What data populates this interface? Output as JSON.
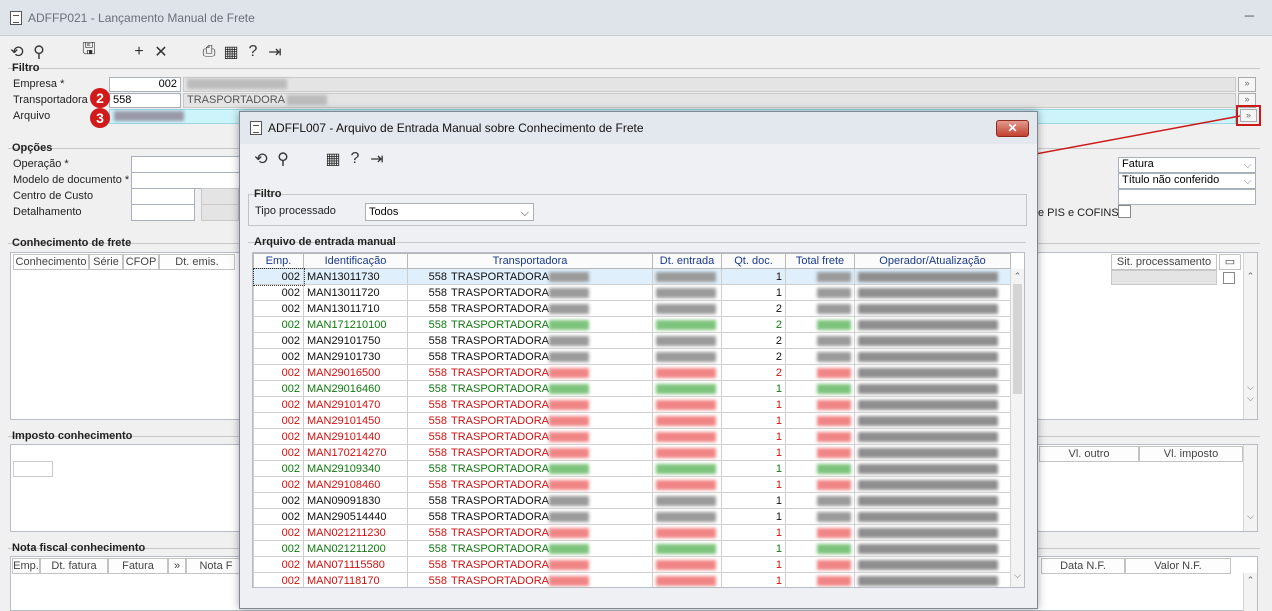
{
  "main_window": {
    "title": "ADFFP021 - Lançamento Manual de Frete",
    "minimize": "─"
  },
  "filtro": {
    "label": "Filtro",
    "empresa_label": "Empresa *",
    "empresa_value": "002",
    "transportadora_label": "Transportadora",
    "transportadora_value": "558",
    "transportadora_name": "TRASPORTADORA",
    "arquivo_label": "Arquivo"
  },
  "opcoes": {
    "label": "Opções",
    "operacao_label": "Operação *",
    "modelo_label": "Modelo de documento *",
    "centro_label": "Centro de Custo",
    "detalhamento_label": "Detalhamento",
    "select1": "Fatura",
    "select2": "Título não conferido",
    "pis_label": "e PIS e COFINS"
  },
  "conhecimento": {
    "label": "Conhecimento de frete",
    "columns": [
      "Conhecimento",
      "Série",
      "CFOP",
      "Dt. emis."
    ],
    "right_column": "Sit. processamento"
  },
  "imposto": {
    "label": "Imposto conhecimento",
    "columns": [
      "Vl. outro",
      "Vl. imposto"
    ]
  },
  "nota": {
    "label": "Nota fiscal conhecimento",
    "columns": [
      "Emp.",
      "Dt. fatura",
      "Fatura",
      "Nota F"
    ],
    "right_columns": [
      "Data N.F.",
      "Valor N.F."
    ]
  },
  "markers": [
    "2",
    "3"
  ],
  "modal": {
    "title": "ADFFL007 - Arquivo de Entrada Manual sobre Conhecimento de Frete",
    "close": "✕",
    "filtro_label": "Filtro",
    "tipo_label": "Tipo processado",
    "tipo_value": "Todos",
    "grid_label": "Arquivo de entrada manual",
    "columns": [
      "Emp.",
      "Identificação",
      "Transportadora",
      "Dt. entrada",
      "Qt. doc.",
      "Total frete",
      "Operador/Atualização"
    ],
    "rows": [
      {
        "emp": "002",
        "id": "MAN13011730",
        "tcode": "558",
        "tname": "TRASPORTADORA",
        "qt": "1",
        "color": "black"
      },
      {
        "emp": "002",
        "id": "MAN13011720",
        "tcode": "558",
        "tname": "TRASPORTADORA",
        "qt": "1",
        "color": "black"
      },
      {
        "emp": "002",
        "id": "MAN13011710",
        "tcode": "558",
        "tname": "TRASPORTADORA",
        "qt": "2",
        "color": "black"
      },
      {
        "emp": "002",
        "id": "MAN171210100",
        "tcode": "558",
        "tname": "TRASPORTADORA",
        "qt": "2",
        "color": "green"
      },
      {
        "emp": "002",
        "id": "MAN29101750",
        "tcode": "558",
        "tname": "TRASPORTADORA",
        "qt": "2",
        "color": "black"
      },
      {
        "emp": "002",
        "id": "MAN29101730",
        "tcode": "558",
        "tname": "TRASPORTADORA",
        "qt": "2",
        "color": "black"
      },
      {
        "emp": "002",
        "id": "MAN29016500",
        "tcode": "558",
        "tname": "TRASPORTADORA",
        "qt": "2",
        "color": "red"
      },
      {
        "emp": "002",
        "id": "MAN29016460",
        "tcode": "558",
        "tname": "TRASPORTADORA",
        "qt": "1",
        "color": "green"
      },
      {
        "emp": "002",
        "id": "MAN29101470",
        "tcode": "558",
        "tname": "TRASPORTADORA",
        "qt": "1",
        "color": "red"
      },
      {
        "emp": "002",
        "id": "MAN29101450",
        "tcode": "558",
        "tname": "TRASPORTADORA",
        "qt": "1",
        "color": "red"
      },
      {
        "emp": "002",
        "id": "MAN29101440",
        "tcode": "558",
        "tname": "TRASPORTADORA",
        "qt": "1",
        "color": "red"
      },
      {
        "emp": "002",
        "id": "MAN170214270",
        "tcode": "558",
        "tname": "TRASPORTADORA",
        "qt": "1",
        "color": "red"
      },
      {
        "emp": "002",
        "id": "MAN29109340",
        "tcode": "558",
        "tname": "TRASPORTADORA",
        "qt": "1",
        "color": "green"
      },
      {
        "emp": "002",
        "id": "MAN29108460",
        "tcode": "558",
        "tname": "TRASPORTADORA",
        "qt": "1",
        "color": "red"
      },
      {
        "emp": "002",
        "id": "MAN09091830",
        "tcode": "558",
        "tname": "TRASPORTADORA",
        "qt": "1",
        "color": "black"
      },
      {
        "emp": "002",
        "id": "MAN290514440",
        "tcode": "558",
        "tname": "TRASPORTADORA",
        "qt": "1",
        "color": "black"
      },
      {
        "emp": "002",
        "id": "MAN021211230",
        "tcode": "558",
        "tname": "TRASPORTADORA",
        "qt": "1",
        "color": "red"
      },
      {
        "emp": "002",
        "id": "MAN021211200",
        "tcode": "558",
        "tname": "TRASPORTADORA",
        "qt": "1",
        "color": "green"
      },
      {
        "emp": "002",
        "id": "MAN071115580",
        "tcode": "558",
        "tname": "TRASPORTADORA",
        "qt": "1",
        "color": "red"
      },
      {
        "emp": "002",
        "id": "MAN07118170",
        "tcode": "558",
        "tname": "TRASPORTADORA",
        "qt": "1",
        "color": "red"
      }
    ]
  },
  "colors": {
    "red": "#d01111",
    "green": "#0f7a0f",
    "black": "#111111",
    "accent": "#cc1a1a"
  }
}
